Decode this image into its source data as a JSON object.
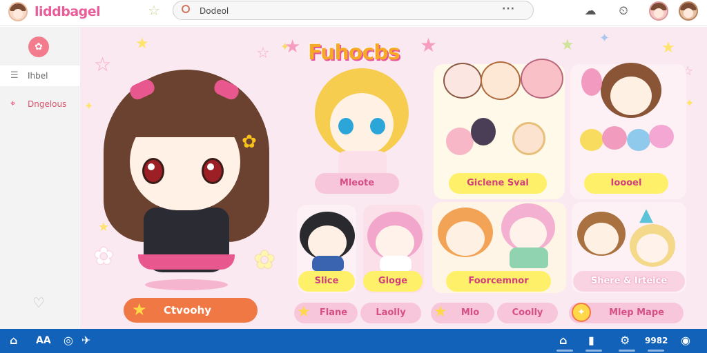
{
  "header": {
    "app_title": "liddbagel",
    "search_value": "Dodeol",
    "search_more": "···"
  },
  "sidebar": {
    "items": [
      {
        "label": "Ihbel"
      },
      {
        "label": "Dngelous"
      }
    ]
  },
  "main": {
    "section_title": "Fuhocbs",
    "cta_label": "Ctvoohy",
    "cards": [
      {
        "label": "Mleote"
      },
      {
        "label": "Giclene Sval"
      },
      {
        "label": "Ioooel"
      },
      {
        "label": "Slice"
      },
      {
        "label": "Gloge"
      },
      {
        "label": "Foorcemnor"
      },
      {
        "label": "Shere & Irteice"
      }
    ],
    "tabs": [
      {
        "label": "Flane"
      },
      {
        "label": "Laolly"
      },
      {
        "label": "Mlo"
      },
      {
        "label": "Coolly"
      },
      {
        "label": "Mlep Mape"
      }
    ]
  },
  "taskbar": {
    "label_ai": "AA",
    "clock": "9982"
  },
  "colors": {
    "accent_pink": "#e85d9a",
    "accent_orange": "#f07845",
    "chip_yellow": "#fff06a",
    "taskbar_blue": "#1362b9"
  }
}
